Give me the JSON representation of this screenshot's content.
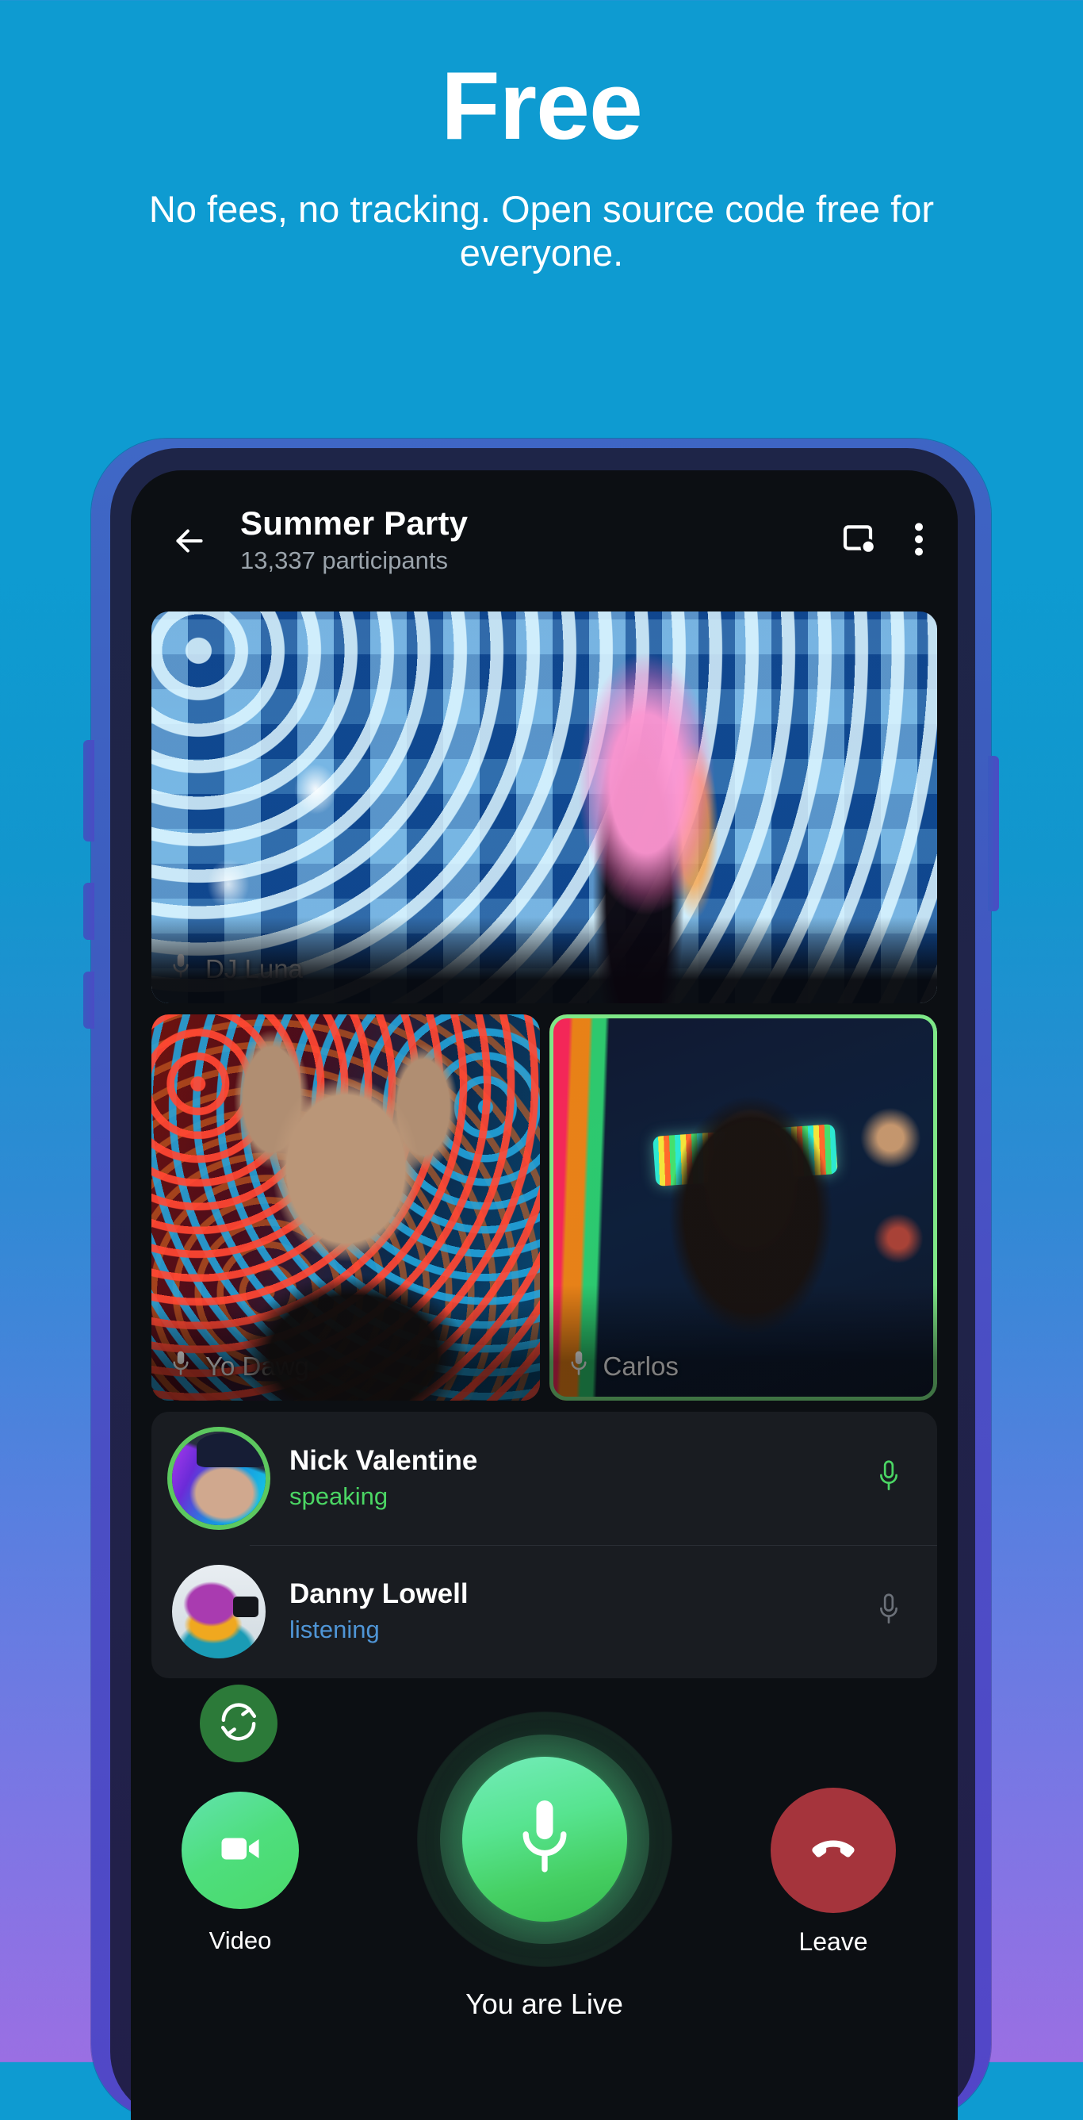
{
  "promo": {
    "title": "Free",
    "subtitle": "No fees, no tracking. Open source code free for everyone."
  },
  "colors": {
    "background_top": "#0e9bd1",
    "background_bottom": "#9a6fe3",
    "phone_shell": "#4a4fc4",
    "phone_bezel": "#212348",
    "screen_bg": "#0c0f13",
    "accent_green": "#4ede7d",
    "speaking_green": "#4bd664",
    "listening_blue": "#4f95d6",
    "leave_red": "#a5343c",
    "active_tile_border": "#7ee787",
    "panel_bg": "#191c21"
  },
  "appbar": {
    "back_icon": "back-arrow-icon",
    "title": "Summer Party",
    "subtitle": "13,337 participants",
    "screen_share_icon": "screen-share-icon",
    "overflow_icon": "more-vertical-icon"
  },
  "video_grid": {
    "tiles": [
      {
        "name": "DJ Luna",
        "mic_icon": "microphone-icon",
        "active": false,
        "art": "v-dj"
      },
      {
        "name": "Yo Dawg",
        "mic_icon": "microphone-icon",
        "active": false,
        "art": "v-dog"
      },
      {
        "name": "Carlos",
        "mic_icon": "microphone-icon",
        "active": true,
        "art": "v-carlos"
      }
    ]
  },
  "participants": [
    {
      "name": "Nick Valentine",
      "status": "speaking",
      "status_kind": "speaking",
      "mic_icon": "microphone-icon",
      "mic_state": "active",
      "avatar": "av-nick",
      "ring": true
    },
    {
      "name": "Danny Lowell",
      "status": "listening",
      "status_kind": "listening",
      "mic_icon": "microphone-muted-icon",
      "mic_state": "muted",
      "avatar": "av-danny",
      "ring": false
    }
  ],
  "controls": {
    "flip_camera_icon": "flip-camera-icon",
    "video_icon": "video-camera-icon",
    "video_label": "Video",
    "mic_icon": "microphone-icon",
    "live_label": "You are Live",
    "leave_icon": "hangup-phone-icon",
    "leave_label": "Leave"
  }
}
